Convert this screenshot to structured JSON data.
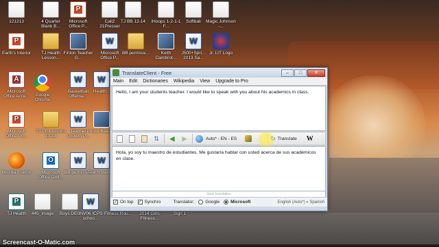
{
  "desktop": {
    "icons": [
      {
        "label": "121213",
        "type": "doc"
      },
      {
        "label": "4 Quarter Blank B...",
        "type": "sheet"
      },
      {
        "label": "Microsoft Office P...",
        "type": "ppt"
      },
      {
        "label": "Call2 21Presser",
        "type": "doc"
      },
      {
        "label": "TJ BB 13-14",
        "type": "doc"
      },
      {
        "label": "iHoops 1-2-1-1 F...",
        "type": "doc"
      },
      {
        "label": "Softball",
        "type": "doc"
      },
      {
        "label": "Magic Johnson -...",
        "type": "doc"
      },
      {
        "label": "Earth's Interior",
        "type": "ppt"
      },
      {
        "label": "TJ Health Lesson...",
        "type": "folder"
      },
      {
        "label": "Finton Teacher G...",
        "type": "photo"
      },
      {
        "label": "Microsoft Office P...",
        "type": "word"
      },
      {
        "label": "BB permissi...",
        "type": "folder"
      },
      {
        "label": "Keith Dambrot...",
        "type": "photo"
      },
      {
        "label": "J500+Spri... 2013 Sa...",
        "type": "word"
      },
      {
        "label": "Jr. LIT Logo",
        "type": "logo"
      },
      {
        "label": "Microsoft Office Acce...",
        "type": "access"
      },
      {
        "label": "Google Chrome",
        "type": "chrome"
      },
      {
        "label": "Basketball Offense...",
        "type": "word"
      },
      {
        "label": "Health...",
        "type": "word"
      },
      {
        "label": "Microsoft Office Po...",
        "type": "ppt"
      },
      {
        "label": "TJ PE Lessons 13-14",
        "type": "folder"
      },
      {
        "label": "Teacher Growth P...",
        "type": "word"
      },
      {
        "label": "Prince Balleti...",
        "type": "photo"
      },
      {
        "label": "Mozilla Firefox",
        "type": "firefox"
      },
      {
        "label": "Microsoft Office Outl...",
        "type": "outlook"
      },
      {
        "label": "BB permissi...",
        "type": "word"
      },
      {
        "label": "Teach stand...",
        "type": "word"
      },
      {
        "label": "TJ Health",
        "type": "pub"
      },
      {
        "label": "445_image",
        "type": "doc"
      },
      {
        "label": "Boys DEC",
        "type": "doc"
      },
      {
        "label": "INV06 ICPS schoo...",
        "type": "word"
      },
      {
        "label": "Fitness Rou...",
        "type": "doc"
      },
      {
        "label": "2014 Girls Fitness...",
        "type": "doc"
      },
      {
        "label": "Sign 1",
        "type": "doc"
      }
    ]
  },
  "window": {
    "title": "TranslateClient - Free",
    "menu": [
      "Main",
      "Edit",
      "Dictionaries",
      "Wikipedia",
      "View",
      "Upgrade to Pro"
    ],
    "source_text": "Hello, I am your students teacher. I would like to speak with you about his academics in class.",
    "toolbar": {
      "language": "Auto* - EN - ES",
      "translate_label": "Translate",
      "wiki_label": "W"
    },
    "translated_text": "Hola, yo soy tu maestro de estudiantes. Me gustaría hablar con usted acerca de sus académicos en clase.",
    "save_link": "Save translation",
    "status": {
      "on_top_label": "On top",
      "synchro_label": "Synchro",
      "translator_label": "Translator:",
      "google_label": "Google",
      "microsoft_label": "Microsoft",
      "language_info": "English (Auto*) » Spanish",
      "on_top_checked": true,
      "synchro_checked": true,
      "selected_translator": "Microsoft"
    },
    "buttons": {
      "minimize": "–",
      "maximize": "□",
      "close": "✕"
    }
  },
  "watermark": "Screencast-O-Matic.com"
}
